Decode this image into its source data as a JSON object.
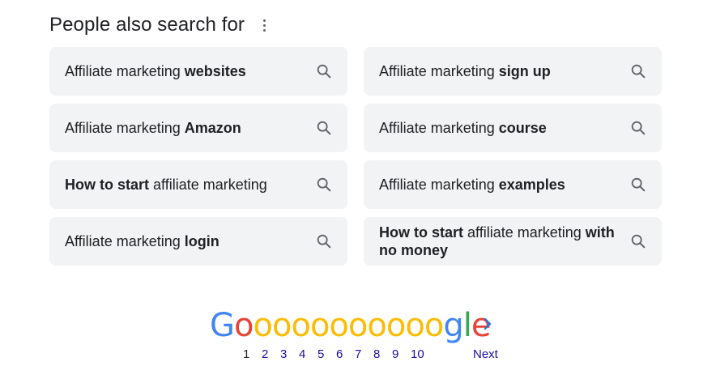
{
  "section": {
    "title": "People also search for"
  },
  "related_searches": [
    {
      "parts": [
        {
          "t": "Affiliate marketing ",
          "b": false
        },
        {
          "t": "websites",
          "b": true
        }
      ]
    },
    {
      "parts": [
        {
          "t": "Affiliate marketing ",
          "b": false
        },
        {
          "t": "sign up",
          "b": true
        }
      ]
    },
    {
      "parts": [
        {
          "t": "Affiliate marketing ",
          "b": false
        },
        {
          "t": "Amazon",
          "b": true
        }
      ]
    },
    {
      "parts": [
        {
          "t": "Affiliate marketing ",
          "b": false
        },
        {
          "t": "course",
          "b": true
        }
      ]
    },
    {
      "parts": [
        {
          "t": "How to start",
          "b": true
        },
        {
          "t": " affiliate marketing",
          "b": false
        }
      ]
    },
    {
      "parts": [
        {
          "t": "Affiliate marketing ",
          "b": false
        },
        {
          "t": "examples",
          "b": true
        }
      ]
    },
    {
      "parts": [
        {
          "t": "Affiliate marketing ",
          "b": false
        },
        {
          "t": "login",
          "b": true
        }
      ]
    },
    {
      "parts": [
        {
          "t": "How to start",
          "b": true
        },
        {
          "t": " affiliate marketing ",
          "b": false
        },
        {
          "t": "with no money",
          "b": true
        }
      ]
    }
  ],
  "icons": {
    "chip_icon": "search-icon",
    "menu_icon": "more-vert-icon",
    "next_icon": "chevron-right-icon"
  },
  "pagination": {
    "logo_letters": [
      {
        "c": "G",
        "color": "#4285f4"
      },
      {
        "c": "o",
        "color": "#ea4335"
      },
      {
        "c": "o",
        "color": "#fbbc05"
      },
      {
        "c": "o",
        "color": "#fbbc05"
      },
      {
        "c": "o",
        "color": "#fbbc05"
      },
      {
        "c": "o",
        "color": "#fbbc05"
      },
      {
        "c": "o",
        "color": "#fbbc05"
      },
      {
        "c": "o",
        "color": "#fbbc05"
      },
      {
        "c": "o",
        "color": "#fbbc05"
      },
      {
        "c": "o",
        "color": "#fbbc05"
      },
      {
        "c": "o",
        "color": "#fbbc05"
      },
      {
        "c": "o",
        "color": "#fbbc05"
      },
      {
        "c": "g",
        "color": "#4285f4"
      },
      {
        "c": "l",
        "color": "#34a853"
      },
      {
        "c": "e",
        "color": "#ea4335"
      }
    ],
    "pages": [
      "1",
      "2",
      "3",
      "4",
      "5",
      "6",
      "7",
      "8",
      "9",
      "10"
    ],
    "current_page": "1",
    "next_label": "Next"
  },
  "colors": {
    "chip_background": "#f1f3f4",
    "link": "#1a0dab",
    "text": "#202124",
    "icon": "#5f6368"
  }
}
